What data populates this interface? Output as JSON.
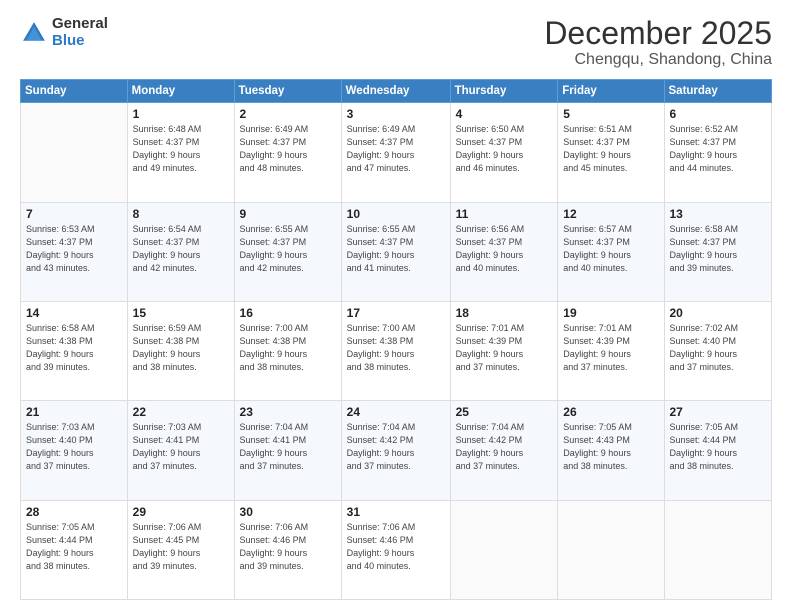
{
  "logo": {
    "general": "General",
    "blue": "Blue"
  },
  "header": {
    "month": "December 2025",
    "location": "Chengqu, Shandong, China"
  },
  "weekdays": [
    "Sunday",
    "Monday",
    "Tuesday",
    "Wednesday",
    "Thursday",
    "Friday",
    "Saturday"
  ],
  "weeks": [
    [
      {
        "day": "",
        "sunrise": "",
        "sunset": "",
        "daylight": ""
      },
      {
        "day": "1",
        "sunrise": "Sunrise: 6:48 AM",
        "sunset": "Sunset: 4:37 PM",
        "daylight": "Daylight: 9 hours and 49 minutes."
      },
      {
        "day": "2",
        "sunrise": "Sunrise: 6:49 AM",
        "sunset": "Sunset: 4:37 PM",
        "daylight": "Daylight: 9 hours and 48 minutes."
      },
      {
        "day": "3",
        "sunrise": "Sunrise: 6:49 AM",
        "sunset": "Sunset: 4:37 PM",
        "daylight": "Daylight: 9 hours and 47 minutes."
      },
      {
        "day": "4",
        "sunrise": "Sunrise: 6:50 AM",
        "sunset": "Sunset: 4:37 PM",
        "daylight": "Daylight: 9 hours and 46 minutes."
      },
      {
        "day": "5",
        "sunrise": "Sunrise: 6:51 AM",
        "sunset": "Sunset: 4:37 PM",
        "daylight": "Daylight: 9 hours and 45 minutes."
      },
      {
        "day": "6",
        "sunrise": "Sunrise: 6:52 AM",
        "sunset": "Sunset: 4:37 PM",
        "daylight": "Daylight: 9 hours and 44 minutes."
      }
    ],
    [
      {
        "day": "7",
        "sunrise": "Sunrise: 6:53 AM",
        "sunset": "Sunset: 4:37 PM",
        "daylight": "Daylight: 9 hours and 43 minutes."
      },
      {
        "day": "8",
        "sunrise": "Sunrise: 6:54 AM",
        "sunset": "Sunset: 4:37 PM",
        "daylight": "Daylight: 9 hours and 42 minutes."
      },
      {
        "day": "9",
        "sunrise": "Sunrise: 6:55 AM",
        "sunset": "Sunset: 4:37 PM",
        "daylight": "Daylight: 9 hours and 42 minutes."
      },
      {
        "day": "10",
        "sunrise": "Sunrise: 6:55 AM",
        "sunset": "Sunset: 4:37 PM",
        "daylight": "Daylight: 9 hours and 41 minutes."
      },
      {
        "day": "11",
        "sunrise": "Sunrise: 6:56 AM",
        "sunset": "Sunset: 4:37 PM",
        "daylight": "Daylight: 9 hours and 40 minutes."
      },
      {
        "day": "12",
        "sunrise": "Sunrise: 6:57 AM",
        "sunset": "Sunset: 4:37 PM",
        "daylight": "Daylight: 9 hours and 40 minutes."
      },
      {
        "day": "13",
        "sunrise": "Sunrise: 6:58 AM",
        "sunset": "Sunset: 4:37 PM",
        "daylight": "Daylight: 9 hours and 39 minutes."
      }
    ],
    [
      {
        "day": "14",
        "sunrise": "Sunrise: 6:58 AM",
        "sunset": "Sunset: 4:38 PM",
        "daylight": "Daylight: 9 hours and 39 minutes."
      },
      {
        "day": "15",
        "sunrise": "Sunrise: 6:59 AM",
        "sunset": "Sunset: 4:38 PM",
        "daylight": "Daylight: 9 hours and 38 minutes."
      },
      {
        "day": "16",
        "sunrise": "Sunrise: 7:00 AM",
        "sunset": "Sunset: 4:38 PM",
        "daylight": "Daylight: 9 hours and 38 minutes."
      },
      {
        "day": "17",
        "sunrise": "Sunrise: 7:00 AM",
        "sunset": "Sunset: 4:38 PM",
        "daylight": "Daylight: 9 hours and 38 minutes."
      },
      {
        "day": "18",
        "sunrise": "Sunrise: 7:01 AM",
        "sunset": "Sunset: 4:39 PM",
        "daylight": "Daylight: 9 hours and 37 minutes."
      },
      {
        "day": "19",
        "sunrise": "Sunrise: 7:01 AM",
        "sunset": "Sunset: 4:39 PM",
        "daylight": "Daylight: 9 hours and 37 minutes."
      },
      {
        "day": "20",
        "sunrise": "Sunrise: 7:02 AM",
        "sunset": "Sunset: 4:40 PM",
        "daylight": "Daylight: 9 hours and 37 minutes."
      }
    ],
    [
      {
        "day": "21",
        "sunrise": "Sunrise: 7:03 AM",
        "sunset": "Sunset: 4:40 PM",
        "daylight": "Daylight: 9 hours and 37 minutes."
      },
      {
        "day": "22",
        "sunrise": "Sunrise: 7:03 AM",
        "sunset": "Sunset: 4:41 PM",
        "daylight": "Daylight: 9 hours and 37 minutes."
      },
      {
        "day": "23",
        "sunrise": "Sunrise: 7:04 AM",
        "sunset": "Sunset: 4:41 PM",
        "daylight": "Daylight: 9 hours and 37 minutes."
      },
      {
        "day": "24",
        "sunrise": "Sunrise: 7:04 AM",
        "sunset": "Sunset: 4:42 PM",
        "daylight": "Daylight: 9 hours and 37 minutes."
      },
      {
        "day": "25",
        "sunrise": "Sunrise: 7:04 AM",
        "sunset": "Sunset: 4:42 PM",
        "daylight": "Daylight: 9 hours and 37 minutes."
      },
      {
        "day": "26",
        "sunrise": "Sunrise: 7:05 AM",
        "sunset": "Sunset: 4:43 PM",
        "daylight": "Daylight: 9 hours and 38 minutes."
      },
      {
        "day": "27",
        "sunrise": "Sunrise: 7:05 AM",
        "sunset": "Sunset: 4:44 PM",
        "daylight": "Daylight: 9 hours and 38 minutes."
      }
    ],
    [
      {
        "day": "28",
        "sunrise": "Sunrise: 7:05 AM",
        "sunset": "Sunset: 4:44 PM",
        "daylight": "Daylight: 9 hours and 38 minutes."
      },
      {
        "day": "29",
        "sunrise": "Sunrise: 7:06 AM",
        "sunset": "Sunset: 4:45 PM",
        "daylight": "Daylight: 9 hours and 39 minutes."
      },
      {
        "day": "30",
        "sunrise": "Sunrise: 7:06 AM",
        "sunset": "Sunset: 4:46 PM",
        "daylight": "Daylight: 9 hours and 39 minutes."
      },
      {
        "day": "31",
        "sunrise": "Sunrise: 7:06 AM",
        "sunset": "Sunset: 4:46 PM",
        "daylight": "Daylight: 9 hours and 40 minutes."
      },
      {
        "day": "",
        "sunrise": "",
        "sunset": "",
        "daylight": ""
      },
      {
        "day": "",
        "sunrise": "",
        "sunset": "",
        "daylight": ""
      },
      {
        "day": "",
        "sunrise": "",
        "sunset": "",
        "daylight": ""
      }
    ]
  ]
}
